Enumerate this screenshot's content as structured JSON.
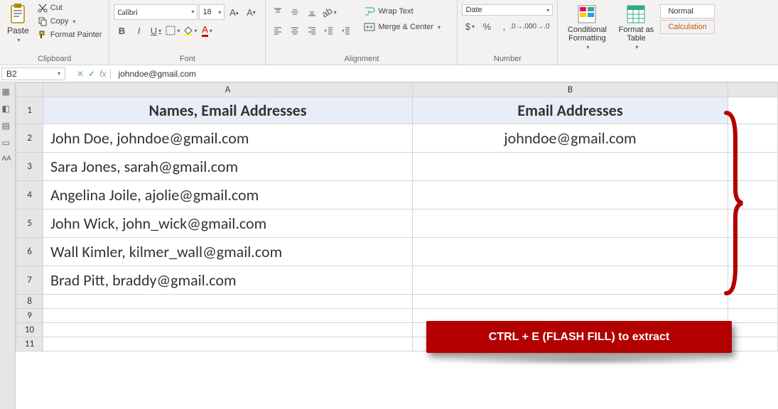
{
  "ribbon": {
    "clipboard": {
      "paste": "Paste",
      "cut": "Cut",
      "copy": "Copy",
      "format_painter": "Format Painter",
      "label": "Clipboard"
    },
    "font": {
      "name": "Calibri",
      "size": "18",
      "label": "Font"
    },
    "alignment": {
      "wrap": "Wrap Text",
      "merge": "Merge & Center",
      "label": "Alignment"
    },
    "number": {
      "format": "Date",
      "label": "Number"
    },
    "styles": {
      "cond": "Conditional Formatting",
      "fmt_table": "Format as Table",
      "normal": "Normal",
      "calc": "Calculation"
    }
  },
  "formula_bar": {
    "cell_ref": "B2",
    "value": "johndoe@gmail.com"
  },
  "sheet": {
    "col_headers": [
      "A",
      "B"
    ],
    "header_row": {
      "a": "Names, Email Addresses",
      "b": "Email Addresses"
    },
    "rows": [
      {
        "n": "2",
        "a": "John Doe, johndoe@gmail.com",
        "b": "johndoe@gmail.com"
      },
      {
        "n": "3",
        "a": "Sara Jones, sarah@gmail.com",
        "b": ""
      },
      {
        "n": "4",
        "a": "Angelina Joile, ajolie@gmail.com",
        "b": ""
      },
      {
        "n": "5",
        "a": "John Wick, john_wick@gmail.com",
        "b": ""
      },
      {
        "n": "6",
        "a": "Wall Kimler, kilmer_wall@gmail.com",
        "b": ""
      },
      {
        "n": "7",
        "a": "Brad Pitt, braddy@gmail.com",
        "b": ""
      }
    ],
    "empty_rows": [
      "8",
      "9",
      "10",
      "11"
    ]
  },
  "callout": "CTRL + E (FLASH FILL) to extract"
}
